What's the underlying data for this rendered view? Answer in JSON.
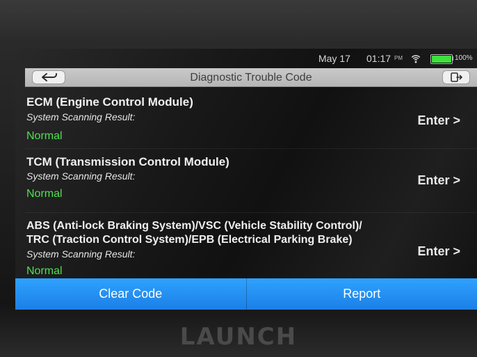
{
  "status_bar": {
    "date": "May 17",
    "time": "01:17",
    "ampm": "PM",
    "battery_percent": 100,
    "battery_label": "100%"
  },
  "titlebar": {
    "title": "Diagnostic Trouble Code",
    "back_icon": "back-arrow-icon",
    "exit_icon": "exit-icon"
  },
  "modules": [
    {
      "name": "ECM (Engine Control Module)",
      "scan_label": "System Scanning Result:",
      "scan_value": "Normal",
      "enter_label": "Enter >"
    },
    {
      "name": "TCM (Transmission Control Module)",
      "scan_label": "System Scanning Result:",
      "scan_value": "Normal",
      "enter_label": "Enter >"
    },
    {
      "name_line1": "ABS (Anti-lock Braking System)/VSC (Vehicle Stability Control)/",
      "name_line2": "TRC (Traction Control System)/EPB (Electrical Parking Brake)",
      "scan_label": "System Scanning Result:",
      "scan_value": "Normal",
      "enter_label": "Enter >"
    }
  ],
  "actions": {
    "clear_code": "Clear Code",
    "report": "Report"
  },
  "branding": {
    "logo_text": "LAUNCH"
  },
  "colors": {
    "normal_green": "#4fe04f",
    "action_blue": "#1b7fe6",
    "titlebar_gray": "#c9c9c9"
  }
}
